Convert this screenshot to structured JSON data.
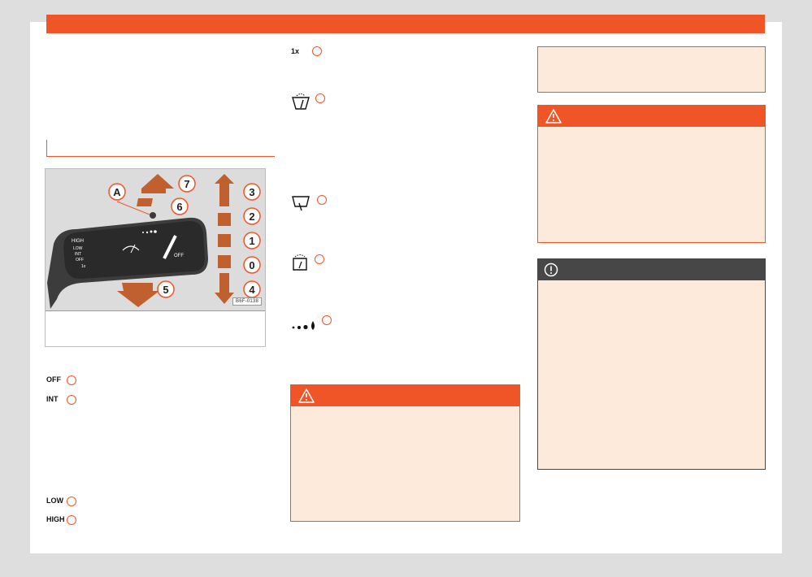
{
  "figure": {
    "code": "B6F-0138",
    "callouts": [
      "A",
      "7",
      "6",
      "3",
      "2",
      "1",
      "0",
      "5",
      "4"
    ],
    "lever_labels": [
      "HIGH",
      "LOW",
      "INT",
      "OFF",
      "1x",
      "OFF"
    ]
  },
  "left_symbols": {
    "off": "OFF",
    "int": "INT",
    "low": "LOW",
    "high": "HIGH"
  },
  "mid_symbols": {
    "one_x": "1x"
  },
  "colors": {
    "accent": "#f05527",
    "note_background": "#fdeadb",
    "caution_header": "#474747"
  },
  "icons": {
    "warning": "warning-triangle-icon",
    "caution": "exclamation-circle-icon",
    "washer": "windscreen-washer-icon",
    "wiper": "windscreen-wiper-icon",
    "rain_sensor": "rain-sensor-icon",
    "rear_washer": "rear-washer-icon"
  }
}
